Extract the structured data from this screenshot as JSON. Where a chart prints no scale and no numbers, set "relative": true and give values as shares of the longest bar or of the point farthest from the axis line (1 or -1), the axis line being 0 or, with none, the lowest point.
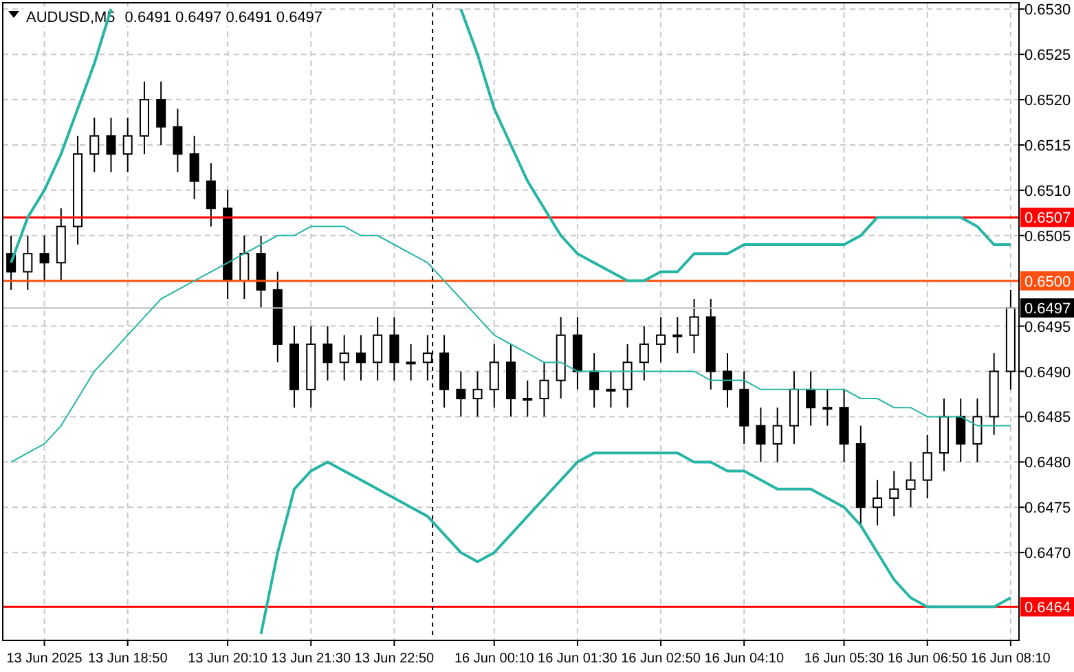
{
  "chart": {
    "title": {
      "symbol": "AUDUSD,M5",
      "quote": "0.6491 0.6497 0.6491 0.6497"
    },
    "price_tags": [
      {
        "label": "0.6507",
        "color": "#ff0000"
      },
      {
        "label": "0.6500",
        "color": "#ff4f0f"
      },
      {
        "label": "0.6497",
        "color": "#000000"
      },
      {
        "label": "0.6464",
        "color": "#ff0000"
      }
    ],
    "chart_data": {
      "type": "candlestick",
      "categories": [
        null,
        null,
        "13 Jun 2025",
        null,
        null,
        null,
        null,
        "13 Jun 18:50",
        null,
        null,
        null,
        null,
        null,
        "13 Jun 20:10",
        null,
        null,
        null,
        null,
        "13 Jun 21:30",
        null,
        null,
        null,
        null,
        "13 Jun 22:50",
        null,
        null,
        null,
        null,
        null,
        "16 Jun 00:10",
        null,
        null,
        null,
        null,
        "16 Jun 01:30",
        null,
        null,
        null,
        null,
        "16 Jun 02:50",
        null,
        null,
        null,
        null,
        "16 Jun 04:10",
        null,
        null,
        null,
        null,
        null,
        "16 Jun 05:30",
        null,
        null,
        null,
        null,
        "16 Jun 06:50",
        null,
        null,
        null,
        null,
        "16 Jun 08:10"
      ],
      "grid": true,
      "ylim": [
        0.64603,
        0.65307
      ],
      "yticks": [
        {
          "value": 0.653,
          "label": "0.6530"
        },
        {
          "value": 0.6525,
          "label": "0.6525"
        },
        {
          "value": 0.652,
          "label": "0.6520"
        },
        {
          "value": 0.6515,
          "label": "0.6515"
        },
        {
          "value": 0.651,
          "label": "0.6510"
        },
        {
          "value": 0.6505,
          "label": "0.6505"
        },
        {
          "value": 0.6495,
          "label": "0.6495"
        },
        {
          "value": 0.649,
          "label": "0.6490"
        },
        {
          "value": 0.6485,
          "label": "0.6485"
        },
        {
          "value": 0.648,
          "label": "0.6480"
        },
        {
          "value": 0.6475,
          "label": "0.6475"
        },
        {
          "value": 0.647,
          "label": "0.6470"
        }
      ],
      "ohlc": [
        [
          0.6503,
          0.6505,
          0.6499,
          0.6501
        ],
        [
          0.6501,
          0.6505,
          0.6499,
          0.6503
        ],
        [
          0.6503,
          0.6505,
          0.65,
          0.6502
        ],
        [
          0.6502,
          0.6508,
          0.65,
          0.6506
        ],
        [
          0.6506,
          0.6516,
          0.6504,
          0.6514
        ],
        [
          0.6514,
          0.6518,
          0.6512,
          0.6516
        ],
        [
          0.6516,
          0.6518,
          0.6512,
          0.6514
        ],
        [
          0.6514,
          0.6518,
          0.6512,
          0.6516
        ],
        [
          0.6516,
          0.6522,
          0.6514,
          0.652
        ],
        [
          0.652,
          0.6522,
          0.6515,
          0.6517
        ],
        [
          0.6517,
          0.6519,
          0.6512,
          0.6514
        ],
        [
          0.6514,
          0.6516,
          0.6509,
          0.6511
        ],
        [
          0.6511,
          0.6513,
          0.6506,
          0.6508
        ],
        [
          0.6508,
          0.651,
          0.6498,
          0.65
        ],
        [
          0.65,
          0.6505,
          0.6498,
          0.6503
        ],
        [
          0.6503,
          0.6505,
          0.6497,
          0.6499
        ],
        [
          0.6499,
          0.6501,
          0.6491,
          0.6493
        ],
        [
          0.6493,
          0.6495,
          0.6486,
          0.6488
        ],
        [
          0.6488,
          0.6495,
          0.6486,
          0.6493
        ],
        [
          0.6493,
          0.6495,
          0.6489,
          0.6491
        ],
        [
          0.6491,
          0.6494,
          0.6489,
          0.6492
        ],
        [
          0.6492,
          0.6494,
          0.6489,
          0.6491
        ],
        [
          0.6491,
          0.6496,
          0.6489,
          0.6494
        ],
        [
          0.6494,
          0.6496,
          0.6489,
          0.6491
        ],
        [
          0.6491,
          0.6493,
          0.6489,
          0.6491
        ],
        [
          0.6491,
          0.6494,
          0.6489,
          0.6492
        ],
        [
          0.6492,
          0.6494,
          0.6486,
          0.6488
        ],
        [
          0.6488,
          0.649,
          0.6485,
          0.6487
        ],
        [
          0.6487,
          0.649,
          0.6485,
          0.6488
        ],
        [
          0.6488,
          0.6493,
          0.6486,
          0.6491
        ],
        [
          0.6491,
          0.6493,
          0.6485,
          0.6487
        ],
        [
          0.6487,
          0.6489,
          0.6485,
          0.6487
        ],
        [
          0.6487,
          0.6491,
          0.6485,
          0.6489
        ],
        [
          0.6489,
          0.6496,
          0.6487,
          0.6494
        ],
        [
          0.6494,
          0.6496,
          0.6488,
          0.649
        ],
        [
          0.649,
          0.6492,
          0.6486,
          0.6488
        ],
        [
          0.6488,
          0.649,
          0.6486,
          0.6488
        ],
        [
          0.6488,
          0.6493,
          0.6486,
          0.6491
        ],
        [
          0.6491,
          0.6495,
          0.6489,
          0.6493
        ],
        [
          0.6493,
          0.6496,
          0.6491,
          0.6494
        ],
        [
          0.6494,
          0.6496,
          0.6492,
          0.6494
        ],
        [
          0.6494,
          0.6498,
          0.6492,
          0.6496
        ],
        [
          0.6496,
          0.6498,
          0.6488,
          0.649
        ],
        [
          0.649,
          0.6492,
          0.6486,
          0.6488
        ],
        [
          0.6488,
          0.649,
          0.6482,
          0.6484
        ],
        [
          0.6484,
          0.6486,
          0.648,
          0.6482
        ],
        [
          0.6482,
          0.6486,
          0.648,
          0.6484
        ],
        [
          0.6484,
          0.649,
          0.6482,
          0.6488
        ],
        [
          0.6488,
          0.649,
          0.6484,
          0.6486
        ],
        [
          0.6486,
          0.6488,
          0.6484,
          0.6486
        ],
        [
          0.6486,
          0.6488,
          0.648,
          0.6482
        ],
        [
          0.6482,
          0.6484,
          0.6473,
          0.6475
        ],
        [
          0.6475,
          0.6478,
          0.6473,
          0.6476
        ],
        [
          0.6476,
          0.6479,
          0.6474,
          0.6477
        ],
        [
          0.6477,
          0.648,
          0.6475,
          0.6478
        ],
        [
          0.6478,
          0.6483,
          0.6476,
          0.6481
        ],
        [
          0.6481,
          0.6487,
          0.6479,
          0.6485
        ],
        [
          0.6485,
          0.6487,
          0.648,
          0.6482
        ],
        [
          0.6482,
          0.6487,
          0.648,
          0.6485
        ],
        [
          0.6485,
          0.6492,
          0.6483,
          0.649
        ],
        [
          0.649,
          0.6499,
          0.6488,
          0.6497
        ]
      ],
      "ref_lines": [
        {
          "axis": "y",
          "value": 0.6507,
          "color": "#ff0000"
        },
        {
          "axis": "y",
          "value": 0.65,
          "color": "#ff4f0f"
        },
        {
          "axis": "y",
          "value": 0.6497,
          "color": "#c0c0c0"
        },
        {
          "axis": "y",
          "value": 0.6464,
          "color": "#ff0000"
        }
      ]
    },
    "indicator": {
      "chart_data": {
        "type": "line",
        "relative": true,
        "ylim": [
          0.64603,
          0.65307
        ],
        "series": [
          {
            "color": "#26b5a5",
            "values": [
              0.6502,
              0.6507,
              0.651,
              0.6514,
              0.6519,
              0.6524,
              0.653,
              null,
              null,
              null,
              null,
              null,
              null,
              null,
              null,
              null,
              null,
              null,
              null,
              null,
              null,
              null,
              null,
              null,
              null,
              null,
              null,
              0.653,
              0.6525,
              0.6519,
              0.6515,
              0.6511,
              0.6508,
              0.6505,
              0.6503,
              0.6502,
              0.6501,
              0.65,
              0.65,
              0.6501,
              0.6501,
              0.6503,
              0.6503,
              0.6503,
              0.6504,
              0.6504,
              0.6504,
              0.6504,
              0.6504,
              0.6504,
              0.6504,
              0.6505,
              0.6507,
              0.6507,
              0.6507,
              0.6507,
              0.6507,
              0.6507,
              0.6506,
              0.6504,
              0.6504
            ]
          },
          {
            "color": "#26b5a5",
            "values": [
              0.648,
              0.6481,
              0.6482,
              0.6484,
              0.6487,
              0.649,
              0.6492,
              0.6494,
              0.6496,
              0.6498,
              0.6499,
              0.65,
              0.6501,
              0.6502,
              0.6503,
              0.6504,
              0.6505,
              0.6505,
              0.6506,
              0.6506,
              0.6506,
              0.6505,
              0.6505,
              0.6504,
              0.6503,
              0.6502,
              0.65,
              0.6498,
              0.6496,
              0.6494,
              0.6493,
              0.6492,
              0.6491,
              0.6491,
              0.649,
              0.649,
              0.649,
              0.649,
              0.649,
              0.649,
              0.649,
              0.649,
              0.6489,
              0.6489,
              0.6489,
              0.6488,
              0.6488,
              0.6488,
              0.6488,
              0.6488,
              0.6488,
              0.6487,
              0.6487,
              0.6486,
              0.6486,
              0.6485,
              0.6485,
              0.6485,
              0.6484,
              0.6484,
              0.6484
            ]
          },
          {
            "color": "#26b5a5",
            "values": [
              null,
              null,
              null,
              null,
              null,
              null,
              null,
              null,
              null,
              null,
              null,
              null,
              null,
              null,
              null,
              0.6461,
              0.647,
              0.6477,
              0.6479,
              0.648,
              0.6479,
              0.6478,
              0.6477,
              0.6476,
              0.6475,
              0.6474,
              0.6472,
              0.647,
              0.6469,
              0.647,
              0.6472,
              0.6474,
              0.6476,
              0.6478,
              0.648,
              0.6481,
              0.6481,
              0.6481,
              0.6481,
              0.6481,
              0.6481,
              0.648,
              0.648,
              0.6479,
              0.6479,
              0.6478,
              0.6477,
              0.6477,
              0.6477,
              0.6476,
              0.6475,
              0.6473,
              0.647,
              0.6467,
              0.6465,
              0.6464,
              0.6464,
              0.6464,
              0.6464,
              0.6464,
              0.6465
            ]
          }
        ]
      }
    }
  }
}
